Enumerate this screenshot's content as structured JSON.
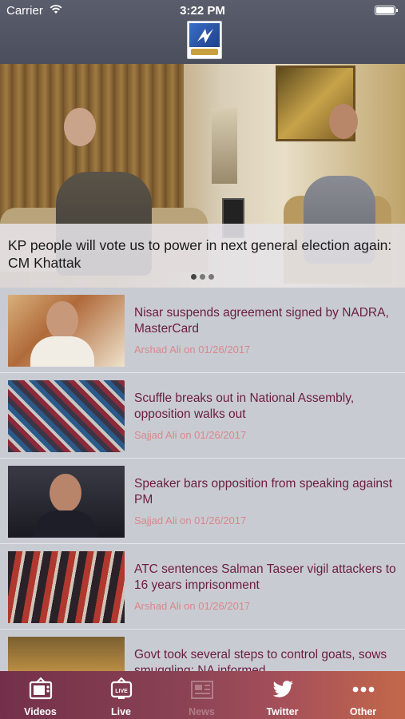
{
  "status_bar": {
    "carrier": "Carrier",
    "time": "3:22 PM",
    "wifi_icon": "wifi-icon",
    "battery_icon": "battery-icon"
  },
  "header": {
    "logo_icon": "app-logo"
  },
  "hero": {
    "title": "KP people will vote us to power in next general election again: CM Khattak",
    "page_count": 3,
    "active_page": 1
  },
  "news": [
    {
      "title": "Nisar suspends agreement signed by NADRA, MasterCard",
      "meta": "Arshad Ali on 01/26/2017"
    },
    {
      "title": "Scuffle breaks out in National Assembly, opposition walks out",
      "meta": "Sajjad Ali on 01/26/2017"
    },
    {
      "title": "Speaker bars opposition from speaking against PM",
      "meta": "Sajjad Ali on 01/26/2017"
    },
    {
      "title": "ATC sentences Salman Taseer vigil attackers to 16 years imprisonment",
      "meta": "Arshad Ali on 01/26/2017"
    },
    {
      "title": "Govt took several steps to control goats, sows smuggling: NA informed",
      "meta": ""
    }
  ],
  "tabs": [
    {
      "label": "Videos",
      "icon": "tv-icon",
      "active": true
    },
    {
      "label": "Live",
      "icon": "live-tv-icon",
      "active": true
    },
    {
      "label": "News",
      "icon": "newspaper-icon",
      "active": false
    },
    {
      "label": "Twitter",
      "icon": "twitter-bird-icon",
      "active": true
    },
    {
      "label": "Other",
      "icon": "more-dots-icon",
      "active": true
    }
  ],
  "colors": {
    "header_bg": "#4f5360",
    "list_bg": "#c9cbd2",
    "headline": "#6a1d3f",
    "meta": "#d8888c",
    "tabbar_start": "#73304a",
    "tabbar_end": "#c3684a"
  }
}
